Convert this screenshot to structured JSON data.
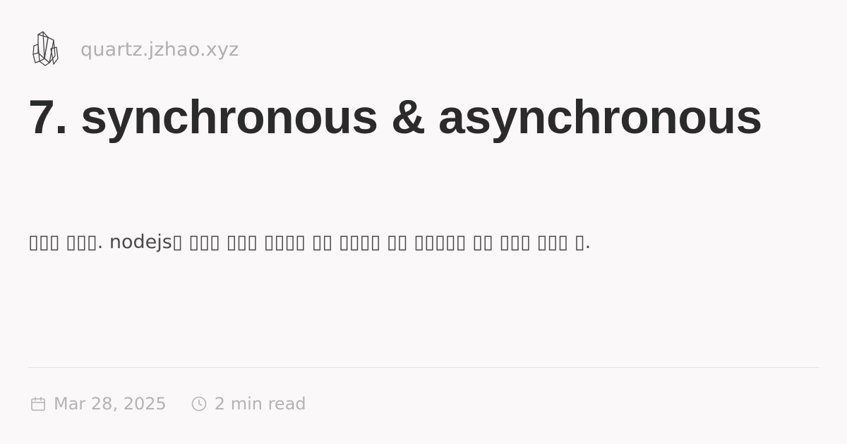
{
  "site": {
    "logo_icon": "crystal-cluster-icon",
    "name": "quartz.jzhao.xyz"
  },
  "post": {
    "title": "7. synchronous & asynchronous",
    "description": "▯▯▯ ▯▯▯. nodejs▯ ▯▯▯ ▯▯▯ ▯▯▯▯ ▯▯ ▯▯▯▯ ▯▯ ▯▯▯▯▯ ▯▯ ▯▯▯ ▯▯▯ ▯."
  },
  "meta": {
    "date_icon": "calendar-icon",
    "date": "Mar 28, 2025",
    "reading_time_icon": "clock-icon",
    "reading_time": "2 min read"
  },
  "colors": {
    "background": "#faf8f8",
    "title": "#2b2b2b",
    "muted": "#b4b4b4"
  }
}
